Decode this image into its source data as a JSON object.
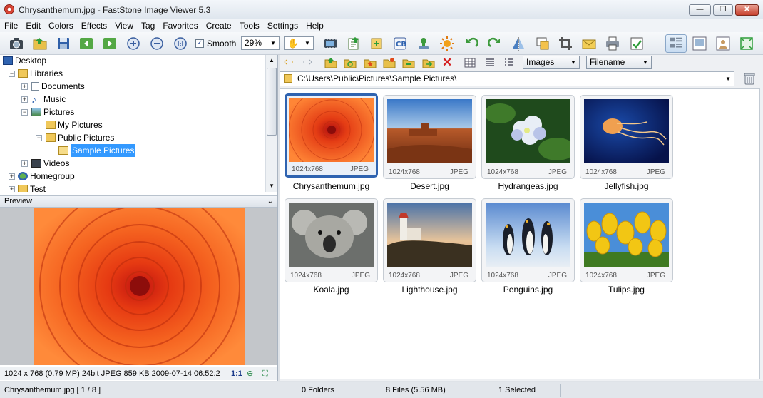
{
  "window": {
    "title": "Chrysanthemum.jpg  -  FastStone Image Viewer 5.3",
    "minimize_label": "—",
    "maximize_label": "❐",
    "close_label": "✕"
  },
  "menu": [
    "File",
    "Edit",
    "Colors",
    "Effects",
    "View",
    "Tag",
    "Favorites",
    "Create",
    "Tools",
    "Settings",
    "Help"
  ],
  "toolbar": {
    "smooth_label": "Smooth",
    "smooth_checked": true,
    "zoom_value": "29%",
    "icons": [
      "camera-icon",
      "open-folder-icon",
      "save-icon",
      "previous-icon",
      "next-icon",
      "zoom-in-icon",
      "zoom-out-icon",
      "actual-size-icon"
    ]
  },
  "tree": {
    "items": [
      {
        "label": "Desktop",
        "icon": "desktop-icon"
      },
      {
        "label": "Libraries",
        "icon": "folder-icon"
      },
      {
        "label": "Documents",
        "icon": "documents-icon"
      },
      {
        "label": "Music",
        "icon": "music-icon"
      },
      {
        "label": "Pictures",
        "icon": "pictures-icon"
      },
      {
        "label": "My Pictures",
        "icon": "folder-icon"
      },
      {
        "label": "Public Pictures",
        "icon": "folder-icon"
      },
      {
        "label": "Sample Pictures",
        "icon": "folder-icon",
        "selected": true
      },
      {
        "label": "Videos",
        "icon": "videos-icon"
      },
      {
        "label": "Homegroup",
        "icon": "homegroup-icon"
      },
      {
        "label": "Test",
        "icon": "folder-icon"
      }
    ]
  },
  "preview": {
    "header": "Preview",
    "info": "1024 x 768 (0.79 MP)  24bit  JPEG   859 KB   2009-07-14 06:52:2",
    "ratio_label": "1:1"
  },
  "browser": {
    "filter_value": "Images",
    "sort_value": "Filename",
    "path": "C:\\Users\\Public\\Pictures\\Sample Pictures\\"
  },
  "thumbnails": [
    {
      "name": "Chrysanthemum.jpg",
      "dims": "1024x768",
      "format": "JPEG",
      "selected": true
    },
    {
      "name": "Desert.jpg",
      "dims": "1024x768",
      "format": "JPEG"
    },
    {
      "name": "Hydrangeas.jpg",
      "dims": "1024x768",
      "format": "JPEG"
    },
    {
      "name": "Jellyfish.jpg",
      "dims": "1024x768",
      "format": "JPEG"
    },
    {
      "name": "Koala.jpg",
      "dims": "1024x768",
      "format": "JPEG"
    },
    {
      "name": "Lighthouse.jpg",
      "dims": "1024x768",
      "format": "JPEG"
    },
    {
      "name": "Penguins.jpg",
      "dims": "1024x768",
      "format": "JPEG"
    },
    {
      "name": "Tulips.jpg",
      "dims": "1024x768",
      "format": "JPEG"
    }
  ],
  "status": {
    "current": "Chrysanthemum.jpg [ 1 / 8 ]",
    "folders": "0 Folders",
    "files": "8 Files (5.56 MB)",
    "selected": "1 Selected"
  }
}
